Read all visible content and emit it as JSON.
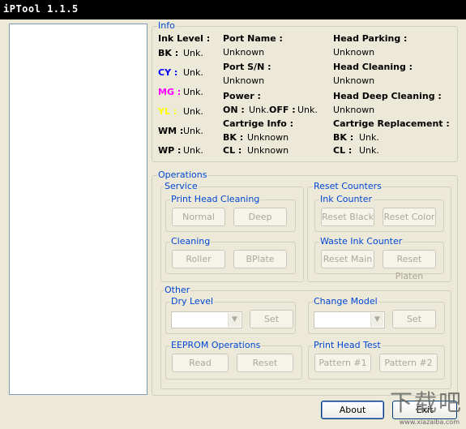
{
  "window": {
    "title": "iPTool 1.1.5"
  },
  "info": {
    "group_label": "Info",
    "ink_level_label": "Ink Level :",
    "ink": [
      {
        "name": "BK :",
        "value": "Unk.",
        "color": "#000000"
      },
      {
        "name": "CY :",
        "value": "Unk.",
        "color": "#0000FF"
      },
      {
        "name": "MG :",
        "value": "Unk.",
        "color": "#FF00FF"
      },
      {
        "name": "YL :",
        "value": "Unk.",
        "color": "#FFFF00"
      },
      {
        "name": "WM :",
        "value": "Unk.",
        "color": "#000000"
      },
      {
        "name": "WP :",
        "value": "Unk.",
        "color": "#000000"
      }
    ],
    "port_name_label": "Port Name :",
    "port_name_value": "Unknown",
    "port_sn_label": "Port S/N :",
    "port_sn_value": "Unknown",
    "power_label": "Power :",
    "power_on_label": "ON :",
    "power_on_value": "Unk.",
    "power_off_label": "OFF :",
    "power_off_value": "Unk.",
    "cartridge_info_label": "Cartrige Info :",
    "cart_bk_label": "BK :",
    "cart_bk_value": "Unknown",
    "cart_cl_label": "CL :",
    "cart_cl_value": "Unknown",
    "head_parking_label": "Head Parking :",
    "head_parking_value": "Unknown",
    "head_cleaning_label": "Head Cleaning :",
    "head_cleaning_value": "Unknown",
    "head_deep_cleaning_label": "Head Deep Cleaning :",
    "head_deep_cleaning_value": "Unknown",
    "cart_replacement_label": "Cartrige Replacement :",
    "repl_bk_label": "BK :",
    "repl_bk_value": "Unk.",
    "repl_cl_label": "CL :",
    "repl_cl_value": "Unk."
  },
  "operations": {
    "group_label": "Operations",
    "service_label": "Service",
    "print_head_cleaning_label": "Print Head Cleaning",
    "normal_button": "Normal",
    "deep_button": "Deep",
    "cleaning_label": "Cleaning",
    "roller_button": "Roller",
    "bplate_button": "BPlate",
    "reset_counters_label": "Reset Counters",
    "ink_counter_label": "Ink Counter",
    "reset_black_button": "Reset Black",
    "reset_color_button": "Reset Color",
    "waste_ink_counter_label": "Waste Ink Counter",
    "reset_main_button": "Reset Main",
    "reset_platen_button": "Reset Platen"
  },
  "other": {
    "group_label": "Other",
    "dry_level_label": "Dry Level",
    "dry_level_value": "",
    "dry_set_button": "Set",
    "change_model_label": "Change Model",
    "change_model_value": "",
    "model_set_button": "Set",
    "eeprom_label": "EEPROM Operations",
    "read_button": "Read",
    "reset_button": "Reset",
    "print_head_test_label": "Print Head Test",
    "pattern1_button": "Pattern #1",
    "pattern2_button": "Pattern #2"
  },
  "footer": {
    "about_button": "About",
    "exit_button": "Exit",
    "watermark": "下载吧",
    "watermark_sub": "www.xiazaiba.com"
  },
  "icons": {
    "combo_arrow": "chevron-down-icon"
  }
}
